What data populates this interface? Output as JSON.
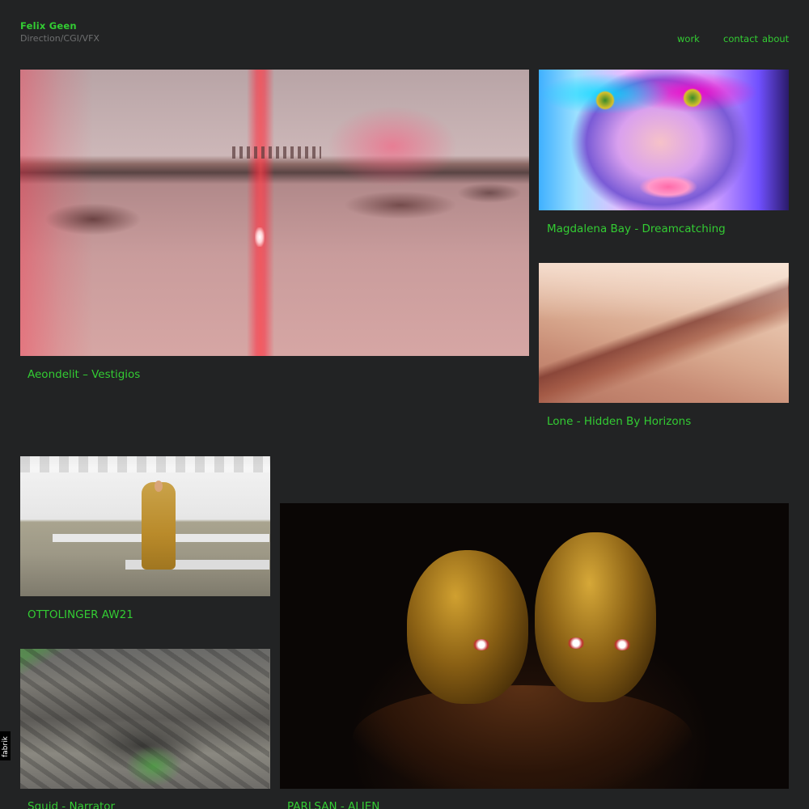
{
  "header": {
    "name": "Felix Geen",
    "tagline": "Direction/CGI/VFX"
  },
  "nav": {
    "work": "work",
    "contact": "contact",
    "about": "about"
  },
  "projects": [
    {
      "title": "Aeondelit – Vestigios"
    },
    {
      "title": "Magdalena Bay - Dreamcatching"
    },
    {
      "title": "Lone - Hidden By Horizons"
    },
    {
      "title": "OTTOLINGER AW21"
    },
    {
      "title": "Squid - Narrator"
    },
    {
      "title": "PARLSAN - ALIEN"
    }
  ],
  "badge": {
    "label": "fabrik"
  },
  "colors": {
    "accent": "#33cc33",
    "background": "#222324",
    "muted": "#6e6f70"
  }
}
